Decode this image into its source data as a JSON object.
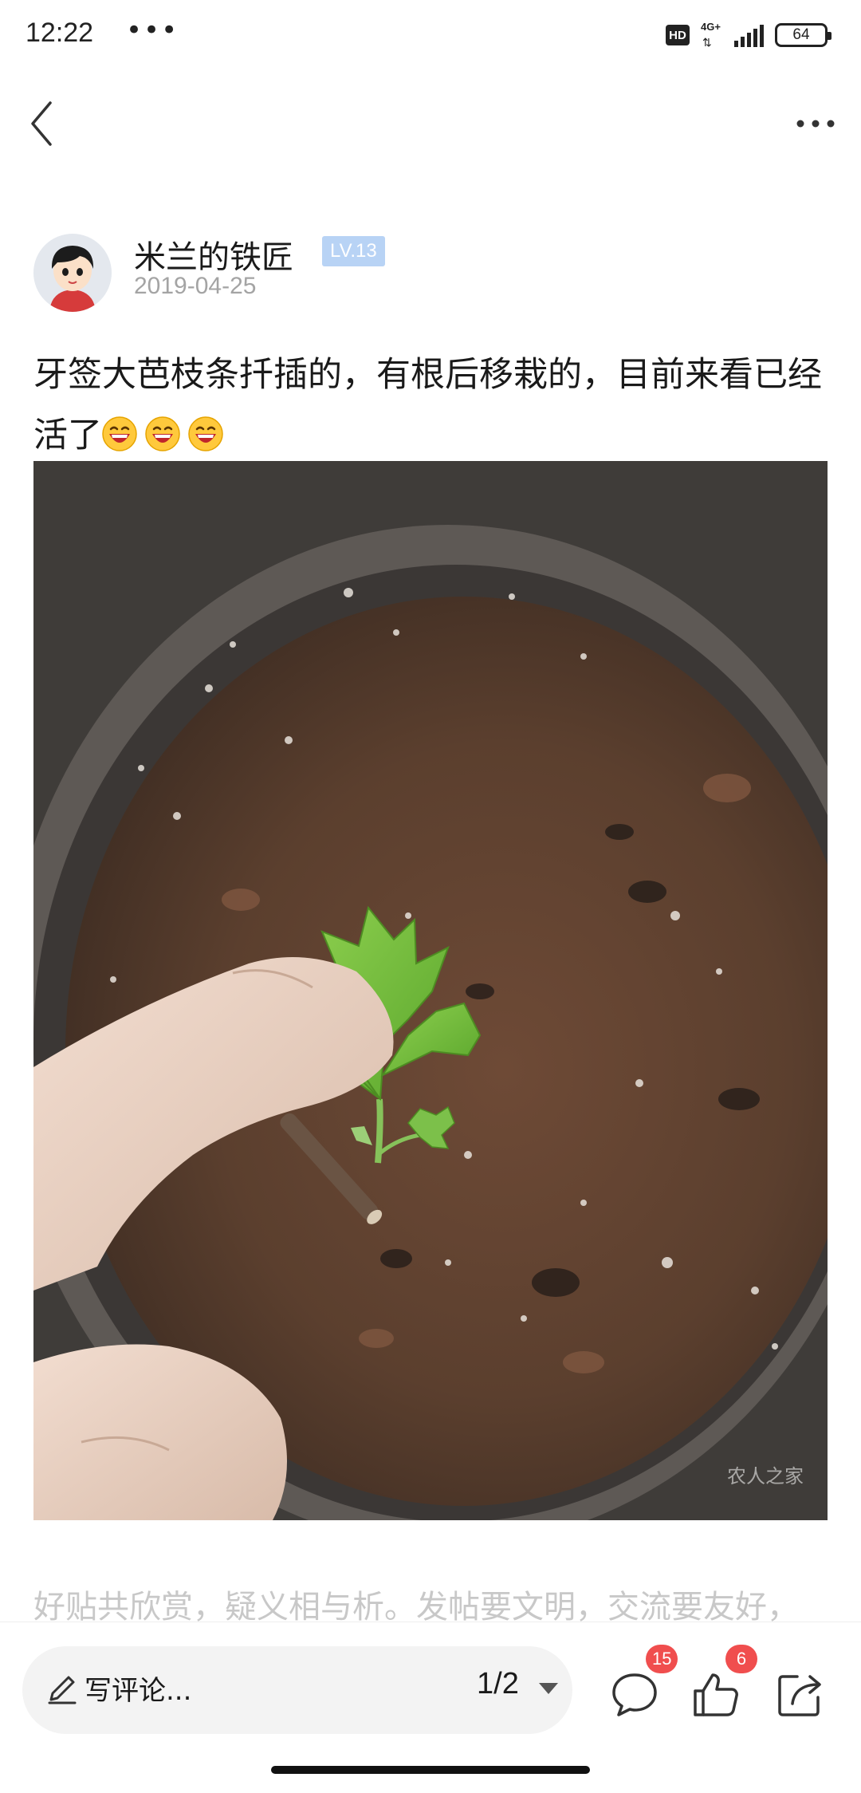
{
  "status_bar": {
    "time": "12:22",
    "dots": "•••",
    "hd_label": "HD",
    "network_label": "4G+",
    "battery_level": "64"
  },
  "nav": {
    "back_icon": "chevron-left-icon",
    "more_icon": "more-horizontal-icon"
  },
  "post": {
    "author": {
      "name": "米兰的铁匠",
      "level": "LV.13",
      "date": "2019-04-25"
    },
    "text": "牙签大芭枝条扦插的，有根后移栽的，目前来看已经活了",
    "emoji_count": 3,
    "image": {
      "description_icon": "fig-cutting-seedling-photo",
      "watermark": "农人之家"
    }
  },
  "guideline": "好贴共欣赏，疑义相与析。发帖要文明，交流要友好，",
  "bottom_bar": {
    "comment_placeholder": "写评论...",
    "page_indicator": "1/2",
    "comment_count": "15",
    "like_count": "6",
    "icons": [
      "pencil-icon",
      "comment-icon",
      "thumbs-up-icon",
      "share-icon"
    ]
  },
  "colors": {
    "level_badge": "#b8d3f5",
    "badge_red": "#f04e4e",
    "muted_text": "#c8c8c8",
    "date_text": "#a4a4a4"
  }
}
